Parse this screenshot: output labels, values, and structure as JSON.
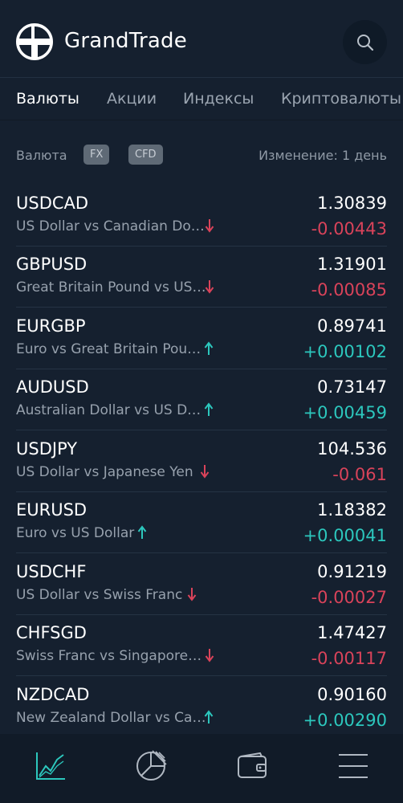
{
  "app": {
    "title": "GrandTrade"
  },
  "tabs": [
    {
      "label": "Валюты",
      "active": true
    },
    {
      "label": "Акции",
      "active": false
    },
    {
      "label": "Индексы",
      "active": false
    },
    {
      "label": "Криптовалюты",
      "active": false
    }
  ],
  "filter": {
    "label": "Валюта",
    "chips": [
      "FX",
      "CFD"
    ],
    "change_label": "Изменение: 1 день"
  },
  "instruments": [
    {
      "symbol": "USDCAD",
      "description": "US Dollar vs Canadian Do…",
      "price": "1.30839",
      "change": "-0.00443",
      "direction": "down"
    },
    {
      "symbol": "GBPUSD",
      "description": "Great Britain Pound vs US…",
      "price": "1.31901",
      "change": "-0.00085",
      "direction": "down"
    },
    {
      "symbol": "EURGBP",
      "description": "Euro vs Great Britain Pou…",
      "price": "0.89741",
      "change": "+0.00102",
      "direction": "up"
    },
    {
      "symbol": "AUDUSD",
      "description": "Australian Dollar vs US D…",
      "price": "0.73147",
      "change": "+0.00459",
      "direction": "up"
    },
    {
      "symbol": "USDJPY",
      "description": "US Dollar vs Japanese Yen",
      "price": "104.536",
      "change": "-0.061",
      "direction": "down"
    },
    {
      "symbol": "EURUSD",
      "description": "Euro vs US Dollar",
      "price": "1.18382",
      "change": "+0.00041",
      "direction": "up"
    },
    {
      "symbol": "USDCHF",
      "description": "US Dollar vs Swiss Franc",
      "price": "0.91219",
      "change": "-0.00027",
      "direction": "down"
    },
    {
      "symbol": "CHFSGD",
      "description": "Swiss Franc vs Singapore…",
      "price": "1.47427",
      "change": "-0.00117",
      "direction": "down"
    },
    {
      "symbol": "NZDCAD",
      "description": "New Zealand Dollar vs Ca…",
      "price": "0.90160",
      "change": "+0.00290",
      "direction": "up"
    }
  ],
  "bottom_nav": [
    {
      "icon": "chart-line-icon",
      "active": true
    },
    {
      "icon": "pie-chart-icon",
      "active": false
    },
    {
      "icon": "wallet-icon",
      "active": false
    },
    {
      "icon": "menu-icon",
      "active": false
    }
  ],
  "colors": {
    "background": "#15202f",
    "negative": "#d9435a",
    "positive": "#2cc7bd",
    "accent": "#2cc7bd"
  }
}
